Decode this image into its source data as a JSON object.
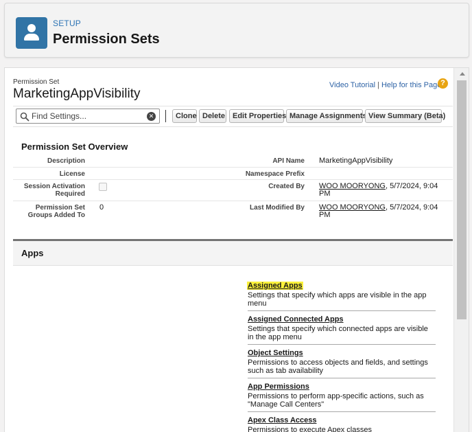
{
  "header": {
    "section": "SETUP",
    "title": "Permission Sets"
  },
  "permission_set": {
    "label": "Permission Set",
    "name": "MarketingAppVisibility"
  },
  "help": {
    "video_tutorial": "Video Tutorial",
    "separator": "|",
    "help_page": "Help for this Page"
  },
  "toolbar": {
    "search_placeholder": "Find Settings...",
    "buttons": {
      "clone": "Clone",
      "delete": "Delete",
      "edit_properties": "Edit Properties",
      "manage_assignments": "Manage Assignments",
      "view_summary": "View Summary (Beta)"
    }
  },
  "overview": {
    "title": "Permission Set Overview",
    "description_label": "Description",
    "description_value": "",
    "api_name_label": "API Name",
    "api_name_value": "MarketingAppVisibility",
    "license_label": "License",
    "license_value": "",
    "namespace_label": "Namespace Prefix",
    "namespace_value": "",
    "session_label_1": "Session Activation",
    "session_label_2": "Required",
    "session_checked": false,
    "created_label": "Created By",
    "created_user": "WOO MOORYONG",
    "created_date_1": ", 5/7/2024, 9:04",
    "created_date_2": "PM",
    "groups_label_1": "Permission Set",
    "groups_label_2": "Groups Added To",
    "groups_value": "0",
    "modified_label": "Last Modified By",
    "modified_user": "WOO MOORYONG",
    "modified_date_1": ", 5/7/2024, 9:04",
    "modified_date_2": "PM"
  },
  "apps": {
    "title": "Apps",
    "items": [
      {
        "title": "Assigned Apps",
        "desc_1": "Settings that specify which apps are visible in the app",
        "desc_2": "menu"
      },
      {
        "title": "Assigned Connected Apps",
        "desc_1": "Settings that specify which connected apps are visible",
        "desc_2": "in the app menu"
      },
      {
        "title": "Object Settings",
        "desc_1": "Permissions to access objects and fields, and settings",
        "desc_2": "such as tab availability"
      },
      {
        "title": "App Permissions",
        "desc_1": "Permissions to perform app-specific actions, such as",
        "desc_2": "\"Manage Call Centers\""
      },
      {
        "title": "Apex Class Access",
        "desc_1": "Permissions to execute Apex classes",
        "desc_2": ""
      }
    ]
  },
  "colors": {
    "accent": "#3174a6",
    "link": "#2d62a5",
    "highlight": "#fbf13b",
    "help_icon": "#e8a412"
  },
  "icons": {
    "header": "user-icon",
    "help": "help-icon",
    "search": "search-icon",
    "clear": "clear-icon"
  }
}
